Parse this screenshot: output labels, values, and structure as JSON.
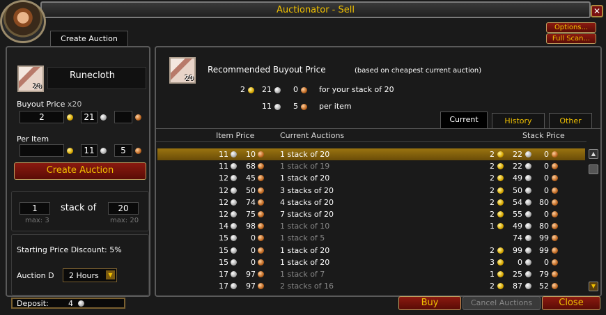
{
  "window": {
    "title": "Auctionator - Sell"
  },
  "tabs_top": {
    "create_auction": "Create Auction"
  },
  "options": {
    "options_label": "Options...",
    "fullscan_label": "Full Scan..."
  },
  "item": {
    "name": "Runecloth",
    "stack_count": "20"
  },
  "buyout": {
    "label": "Buyout Price",
    "mult": "x20",
    "gold": "2",
    "silver": "21",
    "copper": ""
  },
  "per_item": {
    "label": "Per Item",
    "gold": "",
    "silver": "11",
    "copper": "5"
  },
  "create_button": "Create Auction",
  "stacks": {
    "count": "1",
    "stack_of_label": "stack of",
    "size": "20",
    "max_count": "max: 3",
    "max_size": "max: 20"
  },
  "discount": {
    "label": "Starting Price Discount:",
    "value": "5%"
  },
  "duration": {
    "label": "Auction D",
    "value": "2 Hours"
  },
  "recommend": {
    "title": "Recommended Buyout Price",
    "note": "(based on cheapest current auction)",
    "stack_gold": "2",
    "stack_silver": "21",
    "stack_copper": "0",
    "stack_label": "for your stack of 20",
    "item_silver": "11",
    "item_copper": "5",
    "item_label": "per item"
  },
  "result_tabs": {
    "current": "Current",
    "history": "History",
    "other": "Other"
  },
  "columns": {
    "item_price": "Item Price",
    "current_auctions": "Current Auctions",
    "stack_price": "Stack Price"
  },
  "rows": [
    {
      "is": "11",
      "ic": "10",
      "desc": "1 stack of 20",
      "dim": false,
      "sg": "2",
      "ss": "22",
      "sc": "0"
    },
    {
      "is": "11",
      "ic": "68",
      "desc": "1 stack of 19",
      "dim": true,
      "sg": "2",
      "ss": "22",
      "sc": "0"
    },
    {
      "is": "12",
      "ic": "45",
      "desc": "1 stack of 20",
      "dim": false,
      "sg": "2",
      "ss": "49",
      "sc": "0"
    },
    {
      "is": "12",
      "ic": "50",
      "desc": "3 stacks of 20",
      "dim": false,
      "sg": "2",
      "ss": "50",
      "sc": "0"
    },
    {
      "is": "12",
      "ic": "74",
      "desc": "4 stacks of 20",
      "dim": false,
      "sg": "2",
      "ss": "54",
      "sc": "80"
    },
    {
      "is": "12",
      "ic": "75",
      "desc": "7 stacks of 20",
      "dim": false,
      "sg": "2",
      "ss": "55",
      "sc": "0"
    },
    {
      "is": "14",
      "ic": "98",
      "desc": "1 stack of 10",
      "dim": true,
      "sg": "1",
      "ss": "49",
      "sc": "80"
    },
    {
      "is": "15",
      "ic": "0",
      "desc": "1 stack of 5",
      "dim": true,
      "sg": "",
      "ss": "74",
      "sc": "99"
    },
    {
      "is": "15",
      "ic": "0",
      "desc": "1 stack of 20",
      "dim": false,
      "sg": "2",
      "ss": "99",
      "sc": "99"
    },
    {
      "is": "15",
      "ic": "0",
      "desc": "1 stack of 20",
      "dim": false,
      "sg": "3",
      "ss": "0",
      "sc": "0"
    },
    {
      "is": "17",
      "ic": "97",
      "desc": "1 stack of 7",
      "dim": true,
      "sg": "1",
      "ss": "25",
      "sc": "79"
    },
    {
      "is": "17",
      "ic": "97",
      "desc": "2 stacks of 16",
      "dim": true,
      "sg": "2",
      "ss": "87",
      "sc": "52"
    }
  ],
  "footer": {
    "deposit_label": "Deposit:",
    "deposit_value": "4",
    "buy": "Buy",
    "cancel": "Cancel Auctions",
    "close": "Close"
  }
}
